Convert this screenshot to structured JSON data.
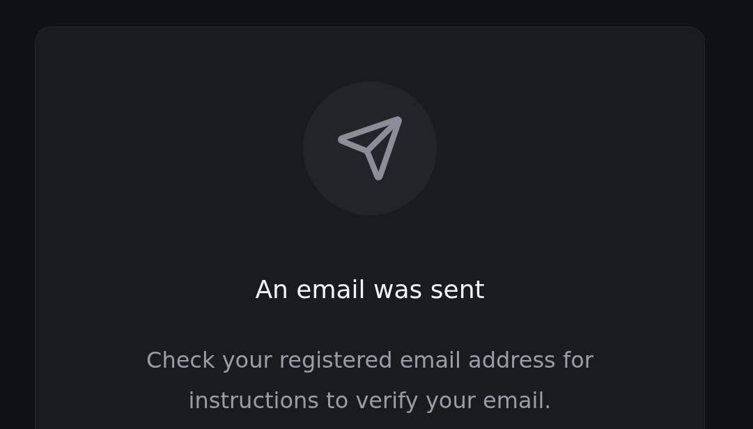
{
  "card": {
    "title": "An email was sent",
    "message": "Check your registered email address for instructions to verify your email."
  }
}
